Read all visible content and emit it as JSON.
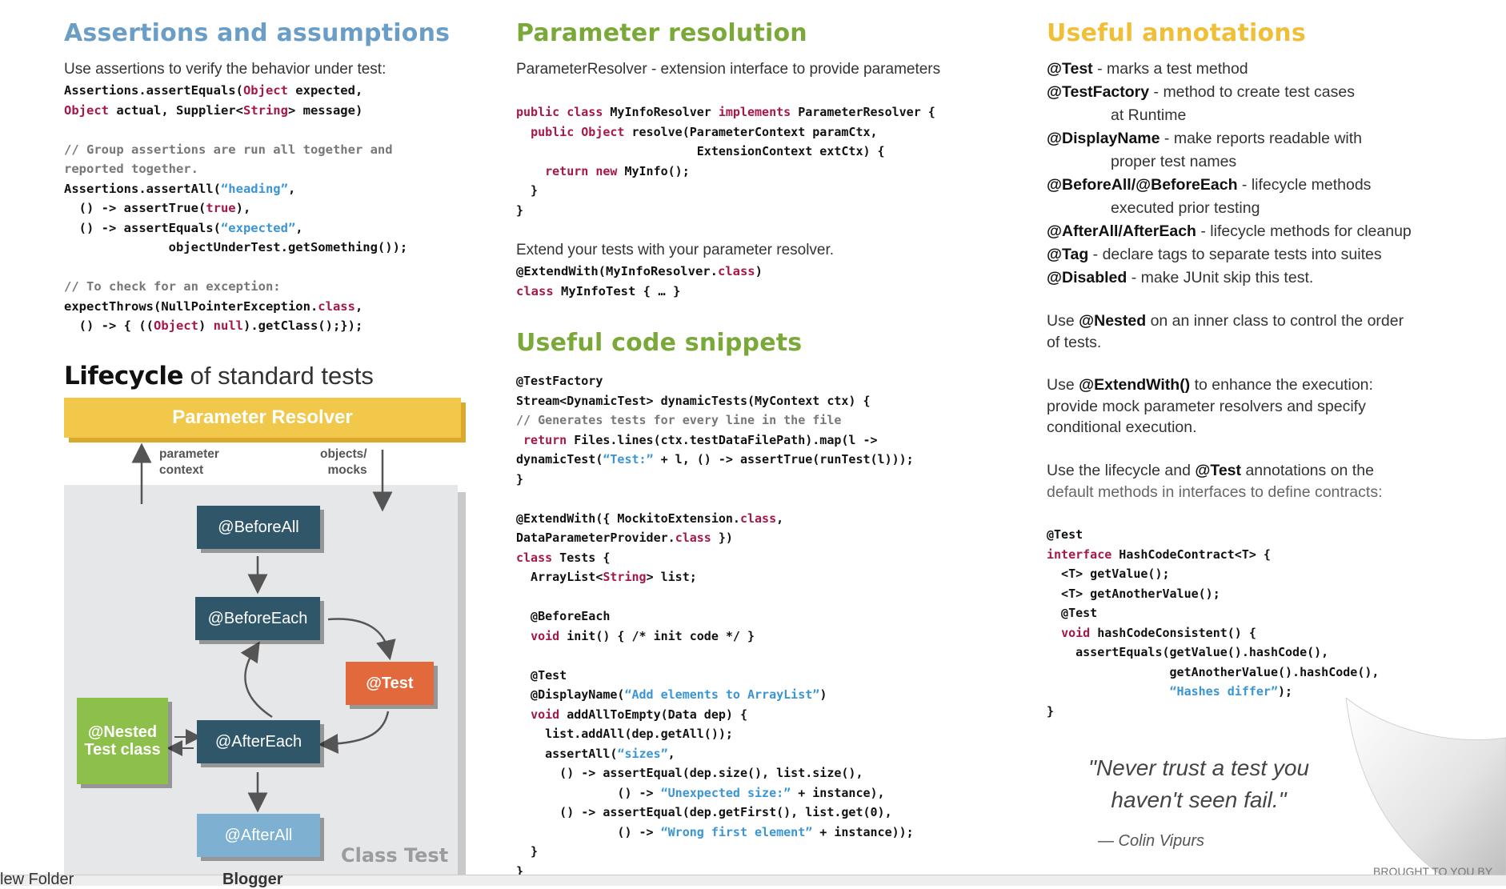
{
  "assertions": {
    "title": "Assertions and assumptions",
    "intro": "Use assertions to verify the behavior under test:",
    "code": [
      [
        {
          "t": "Assertions.assertEquals("
        },
        {
          "t": "Object",
          "c": "kw"
        },
        {
          "t": " expected,"
        }
      ],
      [
        {
          "t": "Object",
          "c": "kw"
        },
        {
          "t": " actual, Supplier<"
        },
        {
          "t": "String",
          "c": "kw"
        },
        {
          "t": "> message)"
        }
      ],
      [],
      [
        {
          "t": "// Group assertions are run all together and",
          "c": "cm"
        }
      ],
      [
        {
          "t": "reported together.",
          "c": "cm"
        }
      ],
      [
        {
          "t": "Assertions.assertAll("
        },
        {
          "t": "“heading”",
          "c": "str"
        },
        {
          "t": ","
        }
      ],
      [
        {
          "t": "  () -> assertTrue("
        },
        {
          "t": "true",
          "c": "kw"
        },
        {
          "t": "),"
        }
      ],
      [
        {
          "t": "  () -> assertEquals("
        },
        {
          "t": "“expected”",
          "c": "str"
        },
        {
          "t": ","
        }
      ],
      [
        {
          "t": "              objectUnderTest.getSomething());"
        }
      ],
      [],
      [
        {
          "t": "// To check for an exception:",
          "c": "cm"
        }
      ],
      [
        {
          "t": "expectThrows(NullPointerException."
        },
        {
          "t": "class",
          "c": "kw"
        },
        {
          "t": ","
        }
      ],
      [
        {
          "t": "  () -> { (("
        },
        {
          "t": "Object",
          "c": "kw"
        },
        {
          "t": ") "
        },
        {
          "t": "null",
          "c": "kw"
        },
        {
          "t": ").getClass();});"
        }
      ]
    ]
  },
  "lifecycle": {
    "title_bold": "Lifecycle",
    "title_rest": " of standard tests",
    "parameter_resolver": "Parameter Resolver",
    "parameter_context": "parameter\ncontext",
    "objects_mocks": "objects/\nmocks",
    "before_all": "@BeforeAll",
    "before_each": "@BeforeEach",
    "test": "@Test",
    "after_each": "@AfterEach",
    "after_all": "@AfterAll",
    "nested_line1": "@Nested",
    "nested_line2": "Test class",
    "class_test": "Class Test"
  },
  "parameter_resolution": {
    "title": "Parameter resolution",
    "intro": "ParameterResolver - extension interface to provide parameters",
    "code": [
      [
        {
          "t": "public class",
          "c": "kw"
        },
        {
          "t": " MyInfoResolver "
        },
        {
          "t": "implements",
          "c": "kw"
        },
        {
          "t": " ParameterResolver {"
        }
      ],
      [
        {
          "t": "  "
        },
        {
          "t": "public Object",
          "c": "kw"
        },
        {
          "t": " resolve(ParameterContext paramCtx,"
        }
      ],
      [
        {
          "t": "                         ExtensionContext extCtx) {"
        }
      ],
      [
        {
          "t": "    "
        },
        {
          "t": "return new",
          "c": "kw"
        },
        {
          "t": " MyInfo();"
        }
      ],
      [
        {
          "t": "  }"
        }
      ],
      [
        {
          "t": "}"
        }
      ]
    ],
    "extend_text": "Extend your tests with your parameter resolver.",
    "code2": [
      [
        {
          "t": "@ExtendWith(MyInfoResolver."
        },
        {
          "t": "class",
          "c": "kw"
        },
        {
          "t": ")"
        }
      ],
      [
        {
          "t": "class",
          "c": "kw"
        },
        {
          "t": " MyInfoTest { … }"
        }
      ]
    ]
  },
  "snippets": {
    "title": "Useful code snippets",
    "code": [
      [
        {
          "t": "@TestFactory"
        }
      ],
      [
        {
          "t": "Stream<DynamicTest> dynamicTests(MyContext ctx) {"
        }
      ],
      [
        {
          "t": "// Generates tests for every line in the file",
          "c": "cm"
        }
      ],
      [
        {
          "t": " "
        },
        {
          "t": "return",
          "c": "kw"
        },
        {
          "t": " Files.lines(ctx.testDataFilePath).map(l ->"
        }
      ],
      [
        {
          "t": "dynamicTest("
        },
        {
          "t": "“Test:”",
          "c": "str"
        },
        {
          "t": " + l, () -> assertTrue(runTest(l)));"
        }
      ],
      [
        {
          "t": "}"
        }
      ],
      [],
      [
        {
          "t": "@ExtendWith({ MockitoExtension."
        },
        {
          "t": "class",
          "c": "kw"
        },
        {
          "t": ","
        }
      ],
      [
        {
          "t": "DataParameterProvider."
        },
        {
          "t": "class",
          "c": "kw"
        },
        {
          "t": " })"
        }
      ],
      [
        {
          "t": "class",
          "c": "kw"
        },
        {
          "t": " Tests {"
        }
      ],
      [
        {
          "t": "  ArrayList<"
        },
        {
          "t": "String",
          "c": "kw"
        },
        {
          "t": "> list;"
        }
      ],
      [],
      [
        {
          "t": "  @BeforeEach"
        }
      ],
      [
        {
          "t": "  "
        },
        {
          "t": "void",
          "c": "kw"
        },
        {
          "t": " init() { /* init code */ }"
        }
      ],
      [],
      [
        {
          "t": "  @Test"
        }
      ],
      [
        {
          "t": "  @DisplayName("
        },
        {
          "t": "“Add elements to ArrayList”",
          "c": "str"
        },
        {
          "t": ")"
        }
      ],
      [
        {
          "t": "  "
        },
        {
          "t": "void",
          "c": "kw"
        },
        {
          "t": " addAllToEmpty(Data dep) {"
        }
      ],
      [
        {
          "t": "    list.addAll(dep.getAll());"
        }
      ],
      [
        {
          "t": "    assertAll("
        },
        {
          "t": "“sizes”",
          "c": "str"
        },
        {
          "t": ","
        }
      ],
      [
        {
          "t": "      () -> assertEqual(dep.size(), list.size(),"
        }
      ],
      [
        {
          "t": "              () -> "
        },
        {
          "t": "“Unexpected size:”",
          "c": "str"
        },
        {
          "t": " + instance),"
        }
      ],
      [
        {
          "t": "      () -> assertEqual(dep.getFirst(), list.get(0),"
        }
      ],
      [
        {
          "t": "              () -> "
        },
        {
          "t": "“Wrong first element”",
          "c": "str"
        },
        {
          "t": " + instance));"
        }
      ],
      [
        {
          "t": "  }"
        }
      ],
      [
        {
          "t": "}"
        }
      ]
    ]
  },
  "annotations": {
    "title": "Useful annotations",
    "items": [
      {
        "name": "@Test",
        "desc": " - marks a test method",
        "cont": ""
      },
      {
        "name": "@TestFactory",
        "desc": " - method to create test cases",
        "cont": "at Runtime"
      },
      {
        "name": "@DisplayName",
        "desc": " - make reports readable with",
        "cont": "proper  test names"
      },
      {
        "name": "@BeforeAll/@BeforeEach",
        "desc": " - lifecycle methods",
        "cont": "executed prior testing"
      },
      {
        "name": "@AfterAll/AfterEach",
        "desc": " - lifecycle methods for cleanup",
        "cont": ""
      },
      {
        "name": "@Tag",
        "desc": " - declare tags to separate tests into suites",
        "cont": ""
      },
      {
        "name": "@Disabled",
        "desc": " - make JUnit skip this test.",
        "cont": ""
      }
    ],
    "nested_pre": "Use ",
    "nested_b": "@Nested",
    "nested_post": " on an inner class to control the order of tests.",
    "extend_pre": "Use ",
    "extend_b": "@ExtendWith()",
    "extend_post": " to enhance the execution: provide mock parameter resolvers and specify conditional execution.",
    "lifecycle_pre": "Use the lifecycle and ",
    "lifecycle_b": "@Test",
    "lifecycle_post": " annotations on the",
    "lifecycle_line2": "default methods in interfaces to define contracts:",
    "code": [
      [
        {
          "t": "@Test"
        }
      ],
      [
        {
          "t": "interface",
          "c": "kw"
        },
        {
          "t": " HashCodeContract<T> {"
        }
      ],
      [
        {
          "t": "  <T> getValue();"
        }
      ],
      [
        {
          "t": "  <T> getAnotherValue();"
        }
      ],
      [
        {
          "t": "  @Test"
        }
      ],
      [
        {
          "t": "  "
        },
        {
          "t": "void",
          "c": "kw"
        },
        {
          "t": " hashCodeConsistent() {"
        }
      ],
      [
        {
          "t": "    assertEquals(getValue().hashCode(),"
        }
      ],
      [
        {
          "t": "                 getAnotherValue().hashCode(),"
        }
      ],
      [
        {
          "t": "                 "
        },
        {
          "t": "“Hashes differ”",
          "c": "str"
        },
        {
          "t": ");"
        }
      ],
      [
        {
          "t": "}"
        }
      ]
    ],
    "quote_line1": "\"Never trust a test you",
    "quote_line2": "haven't seen fail.\"",
    "quote_author": "— Colin Vipurs",
    "brought": "BROUGHT TO YOU BY"
  },
  "bottom": {
    "left": "lew Folder",
    "mid": "Blogger"
  },
  "colors": {
    "blue_heading": "#6b9ec6",
    "green_heading": "#7aa93a",
    "yellow_heading": "#efbf3a",
    "keyword": "#a5174a",
    "string": "#3a95d4",
    "resolver_bar": "#f2c84b"
  }
}
